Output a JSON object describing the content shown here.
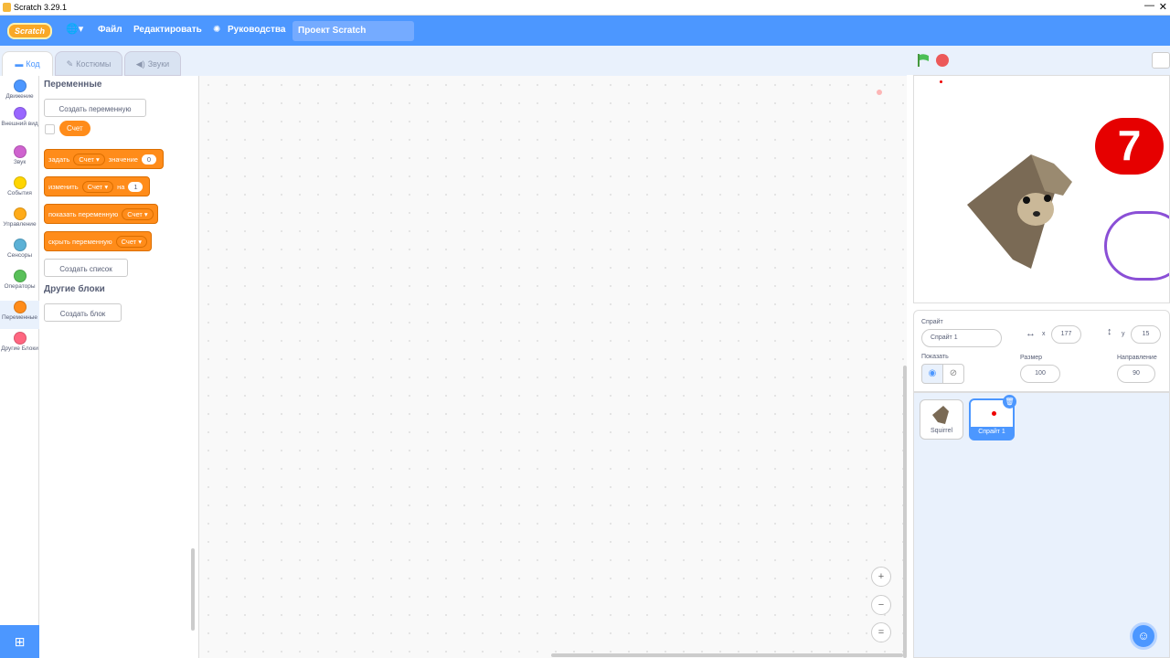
{
  "window": {
    "title": "Scratch 3.29.1",
    "min": "—",
    "close": "✕"
  },
  "menu": {
    "logo": "Scratch",
    "lang": "🌐▾",
    "file": "Файл",
    "edit": "Редактировать",
    "tutorials": "Руководства",
    "project_title": "Проект Scratch"
  },
  "tabs": {
    "code": "Код",
    "costumes": "Костюмы",
    "sounds": "Звуки"
  },
  "categories": [
    {
      "label": "Движение",
      "color": "#4c97ff"
    },
    {
      "label": "Внешний вид",
      "color": "#9966ff"
    },
    {
      "label": "Звук",
      "color": "#cf63cf"
    },
    {
      "label": "События",
      "color": "#ffd500"
    },
    {
      "label": "Управление",
      "color": "#ffab19"
    },
    {
      "label": "Сенсоры",
      "color": "#5cb1d6"
    },
    {
      "label": "Операторы",
      "color": "#59c059"
    },
    {
      "label": "Переменные",
      "color": "#ff8c1a"
    },
    {
      "label": "Другие Блоки",
      "color": "#ff6680"
    }
  ],
  "palette": {
    "variables_title": "Переменные",
    "make_variable": "Создать переменную",
    "var_name": "Счет",
    "set_block": {
      "a": "задать",
      "var": "Счет ▾",
      "b": "значение",
      "val": "0"
    },
    "change_block": {
      "a": "изменить",
      "var": "Счет ▾",
      "b": "на",
      "val": "1"
    },
    "show_block": {
      "a": "показать переменную",
      "var": "Счет ▾"
    },
    "hide_block": {
      "a": "скрыть переменную",
      "var": "Счет ▾"
    },
    "make_list": "Создать список",
    "myblocks_title": "Другие блоки",
    "make_block": "Создать блок"
  },
  "zoom": {
    "in": "+",
    "out": "−",
    "reset": "="
  },
  "sprite_info": {
    "sprite_label": "Спрайт",
    "sprite_name": "Спрайт 1",
    "x_label": "x",
    "x": "177",
    "y_label": "y",
    "y": "15",
    "show_label": "Показать",
    "size_label": "Размер",
    "size": "100",
    "dir_label": "Направление",
    "direction": "90"
  },
  "sprites": [
    {
      "name": "Squirrel"
    },
    {
      "name": "Спрайт 1"
    }
  ],
  "stage_sprite": {
    "number": "7"
  }
}
